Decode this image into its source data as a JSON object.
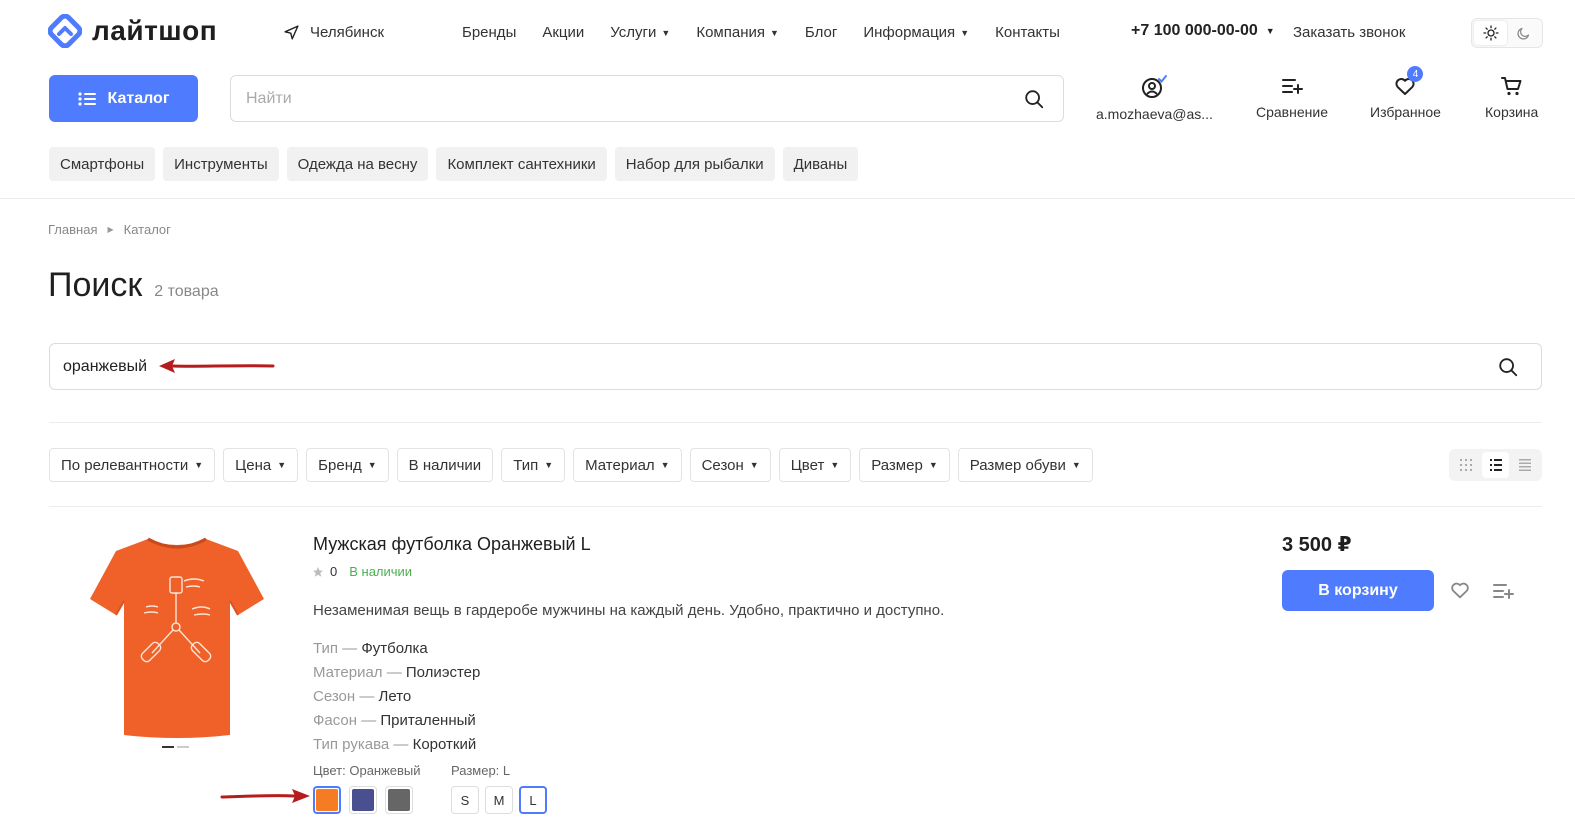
{
  "header": {
    "logo_text": "лайтшоп",
    "city": "Челябинск",
    "nav": [
      {
        "label": "Бренды"
      },
      {
        "label": "Акции"
      },
      {
        "label": "Услуги",
        "dropdown": true
      },
      {
        "label": "Компания",
        "dropdown": true
      },
      {
        "label": "Блог"
      },
      {
        "label": "Информация",
        "dropdown": true
      },
      {
        "label": "Контакты"
      }
    ],
    "phone": "+7 100 000-00-00",
    "callback": "Заказать звонок",
    "catalog_label": "Каталог",
    "search_placeholder": "Найти",
    "icons": {
      "account": "a.mozhaeva@as...",
      "compare": "Сравнение",
      "favorites": "Избранное",
      "favorites_count": "4",
      "cart": "Корзина"
    },
    "chips": [
      "Смартфоны",
      "Инструменты",
      "Одежда на весну",
      "Комплект сантехники",
      "Набор для рыбалки",
      "Диваны"
    ]
  },
  "breadcrumb": [
    "Главная",
    "Каталог"
  ],
  "page": {
    "title": "Поиск",
    "count": "2 товара",
    "search_value": "оранжевый"
  },
  "filters": [
    {
      "label": "По релевантности",
      "dropdown": true
    },
    {
      "label": "Цена",
      "dropdown": true
    },
    {
      "label": "Бренд",
      "dropdown": true
    },
    {
      "label": "В наличии",
      "dropdown": false
    },
    {
      "label": "Тип",
      "dropdown": true
    },
    {
      "label": "Материал",
      "dropdown": true
    },
    {
      "label": "Сезон",
      "dropdown": true
    },
    {
      "label": "Цвет",
      "dropdown": true
    },
    {
      "label": "Размер",
      "dropdown": true
    },
    {
      "label": "Размер обуви",
      "dropdown": true
    }
  ],
  "product": {
    "title": "Мужская футболка Оранжевый L",
    "rating": "0",
    "stock": "В наличии",
    "description": "Незаменимая вещь в гардеробе мужчины на каждый день. Удобно, практично и доступно.",
    "props": [
      {
        "key": "Тип",
        "value": "Футболка"
      },
      {
        "key": "Материал",
        "value": "Полиэстер"
      },
      {
        "key": "Сезон",
        "value": "Лето"
      },
      {
        "key": "Фасон",
        "value": "Приталенный"
      },
      {
        "key": "Тип рукава",
        "value": "Короткий"
      }
    ],
    "color_label": "Цвет: Оранжевый",
    "size_label": "Размер: L",
    "colors": [
      "#f57c22",
      "#4a4f8f",
      "#666666"
    ],
    "selected_color": 0,
    "sizes": [
      "S",
      "M",
      "L"
    ],
    "selected_size": 2,
    "price": "3 500 ₽",
    "buy_label": "В корзину"
  },
  "colors": {
    "accent": "#4f7cff",
    "stock_green": "#4caf50",
    "annotation_arrow": "#b71c1c"
  }
}
